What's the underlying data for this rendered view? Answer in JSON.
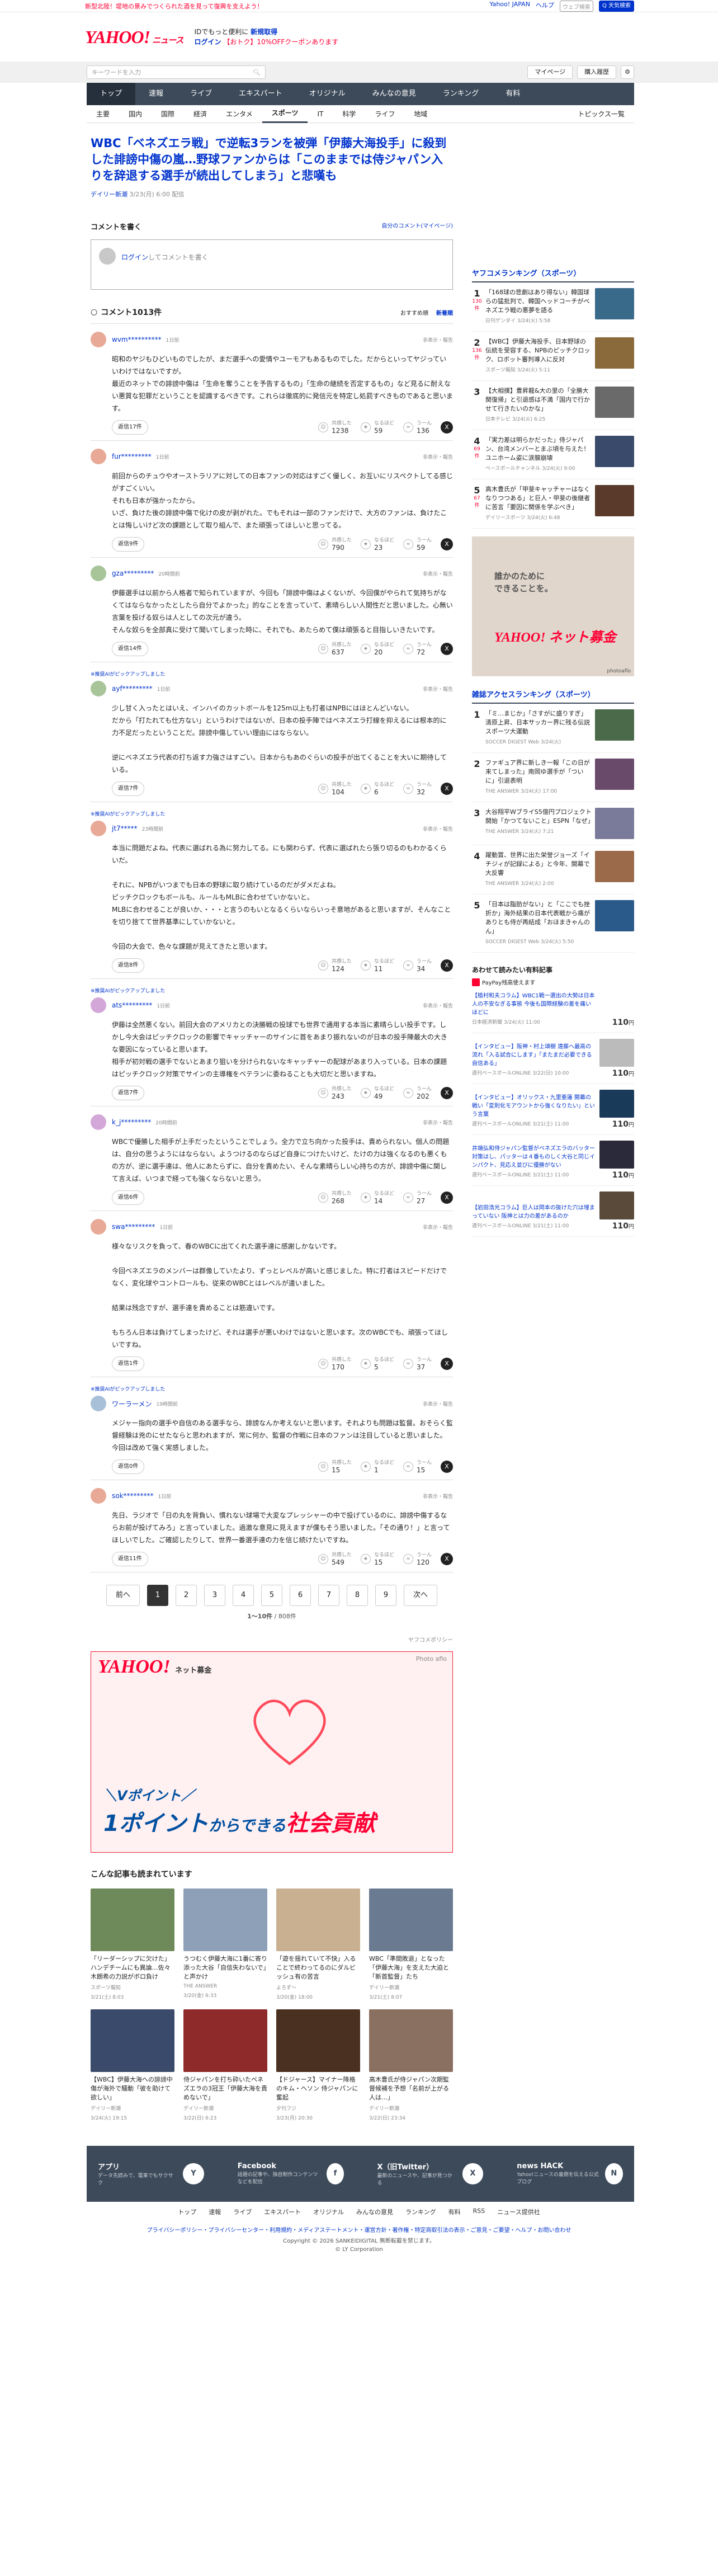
{
  "topstrip": {
    "left": "新型北陸！堤地の景みでつくられた酒を見って復興を支えよう！",
    "links": [
      "Yahoo! JAPAN",
      "ヘルプ"
    ],
    "search_placeholder": "ウェブ検索",
    "search_btn": "Q 天気検索"
  },
  "header": {
    "logo": "YAHOO!",
    "logo_sub": "ニュース",
    "line1": "IDでもっと便利に",
    "line1_link": "新規取得",
    "line2_login": "ログイン",
    "line2_mid": "【おトク】10%OFFクーポンあります",
    "japan": "JAPAN"
  },
  "graybar": {
    "search_placeholder": "キーワードを入力",
    "buttons": [
      "マイページ",
      "購入履歴"
    ]
  },
  "nav1": [
    "トップ",
    "速報",
    "ライブ",
    "エキスパート",
    "オリジナル",
    "みんなの意見",
    "ランキング",
    "有料"
  ],
  "nav2": [
    "主要",
    "国内",
    "国際",
    "経済",
    "エンタメ",
    "スポーツ",
    "IT",
    "科学",
    "ライフ",
    "地域"
  ],
  "nav2_right": "トピックス一覧",
  "article": {
    "title": "WBC「ベネズエラ戦」で逆転3ランを被弾「伊藤大海投手」に殺到した誹謗中傷の嵐…野球ファンからは「このままでは侍ジャパン入りを辞退する選手が続出してしまう」と悲嘆も",
    "source": "デイリー新潮",
    "date": "3/23(月) 6:00",
    "date_suffix": "配信"
  },
  "comment_write": {
    "title": "コメントを書く",
    "link": "自分のコメント(マイページ)",
    "login": "ログイン",
    "placeholder": "してコメントを書く"
  },
  "comments_head": {
    "count": "コメント1013件",
    "sort": [
      "おすすめ順",
      "新着順"
    ]
  },
  "reply_label": "返信",
  "report": "非表示・報告",
  "reactions": [
    "共感した",
    "なるほど",
    "うーん"
  ],
  "comments": [
    {
      "pick": "",
      "name": "wvm**********",
      "time": "1日前",
      "color": "#e8a996",
      "text": "昭和のヤジもひどいものでしたが、まだ選手への愛情やユーモアもあるものでした。だからといってヤジっていいわけではないですが。\n最近のネットでの誹謗中傷は「生命を奪うことを予告するもの」「生命の継続を否定するもの」など見るに耐えない悪質な犯罪だということを認識するべきです。これらは徹底的に発信元を特定し処罰すべきものであると思います。",
      "replies": "返信17件",
      "r": [
        "1238",
        "59",
        "136"
      ]
    },
    {
      "pick": "",
      "name": "fur*********",
      "time": "1日前",
      "color": "#e8a996",
      "text": "前回からのチュウやオーストラリアに対しての日本ファンの対応はすごく優しく、お互いにリスペクトしてる感じがすごくいい。\nそれも日本が強かったから。\nいざ、負けた後の誹謗中傷で化けの皮が剥がれた。でもそれは一部のファンだけで、大方のファンは、負けたことは悔しいけど次の課題として取り組んで、また頑張ってほしいと思ってる。",
      "replies": "返信9件",
      "r": [
        "790",
        "23",
        "59"
      ]
    },
    {
      "pick": "",
      "name": "gza*********",
      "time": "20時間前",
      "color": "#a8c59a",
      "text": "伊藤選手は以前から人格者で知られていますが、今回も「誹謗中傷はよくないが、今回僕がやられて気持ちがなくてはならなかったとしたら自分でよかった」的なことを言っていて、素晴らしい人間性だと思いました。心無い言葉を投げる奴らは人としての次元が違う。\nそんな奴らを全部真に受けて聞いてしまった時に、それでも、あたらめて僕は頑張ると目指しいきたいです。",
      "replies": "返信14件",
      "r": [
        "637",
        "20",
        "72"
      ]
    },
    {
      "pick": "※推奨AIがピックアップしました",
      "name": "ayf*********",
      "time": "1日前",
      "color": "#a8c59a",
      "text": "少し甘く入ったとはいえ、インハイのカットボールを125m以上も打者はNPBにはほとんどいない。\nだから「打たれても仕方ない」というわけではないが、日本の投手陣ではベネズエラ打線を抑えるには根本的に力不足だったということだ。誹謗中傷していい理由にはならない。\n\n逆にベネズエラ代表の打ち返す力強さはすごい。日本からもあのぐらいの投手が出てくることを大いに期待している。",
      "replies": "返信7件",
      "r": [
        "104",
        "6",
        "32"
      ]
    },
    {
      "pick": "※推奨AIがピックアップしました",
      "name": "jt7*****",
      "time": "23時間前",
      "color": "#e8a996",
      "text": "本当に問題だよね。代表に選ばれる為に努力してる。にも関わらず、代表に選ばれたら張り切るのもわかるくらいだ。\n\nそれに、NPBがいつまでも日本の野球に取り続けているのだがダメだよね。\nピッチクロックもボールも、ルールもMLBに合わせていかないと。\nMLBに合わせることが良いか、・・・と言うのもいとなるくらいならいっそ意地があると思いますが、そんなことを切り捨てて世界基準にしていかないと。\n\n今回の大会で、色々な課題が見えてきたと思います。",
      "replies": "返信8件",
      "r": [
        "124",
        "11",
        "34"
      ]
    },
    {
      "pick": "※推奨AIがピックアップしました",
      "name": "ats*********",
      "time": "1日前",
      "color": "#d3a8d8",
      "text": "伊藤は全然悪くない。前回大会のアメリカとの決勝戦の投球でも世界で通用する本当に素晴らしい投手です。しかし今大会はピッチクロックの影響でキャッチャーのサインに首をあまり振れないのが日本の投手陣最大の大きな要因になっていると思います。\n相手が初対戦の選手でないとあまり狙いを分けられないなキャッチャーの配球があまり入っている。日本の課題はピッチクロック対策でサインの主導権をベテランに委ねることも大切だと思いますね。",
      "replies": "返信7件",
      "r": [
        "243",
        "49",
        "202"
      ]
    },
    {
      "pick": "",
      "name": "k_j*********",
      "time": "20時間前",
      "color": "#d3a8d8",
      "text": "WBCで優勝した相手が上手だったということでしょう。全力で立ち向かった投手は、責められない。個人の問題は、自分の思うようにはならない。ようつけるのならばど自身につけたいけど、たけの力は強くなるのも悪くもの方が、逆に選手達は、他人にあたらずに、自分を責めたい、そんな素晴らしい心持ちの方が、誹謗中傷に関して言えば、いつまで経っても強くならないと思う。",
      "replies": "返信6件",
      "r": [
        "268",
        "14",
        "27"
      ]
    },
    {
      "pick": "",
      "name": "swa*********",
      "time": "1日前",
      "color": "#e8a996",
      "text": "様々なリスクを負って、春のWBCに出てくれた選手達に感謝しかないです。\n\n今回ベネズエラのメンバーは群像していたより、ずっとレベルが高いと感じました。特に打者はスピードだけでなく、変化球やコントロールも、従来のWBCとはレベルが違いました。\n\n結果は残念ですが、選手達を責めることは筋違いです。\n\nもちろん日本は負けてしまったけど、それは選手が悪いわけではないと思います。次のWBCでも、頑張ってほしいですね。",
      "replies": "返信1件",
      "r": [
        "170",
        "5",
        "37"
      ]
    },
    {
      "pick": "※推奨AIがピックアップしました",
      "name": "ワーラーメン",
      "time": "19時間前",
      "color": "#a8c0d8",
      "text": "メジャー指向の選手や自信のある選手なら、誹謗なんか考えないと思います。それよりも問題は監督。おそらく監督経験は兇のにせたならと思われますが、常に何か、監督の作戦に日本のファンは注目していると思いました。今回は改めて強く実感しました。",
      "replies": "返信0件",
      "r": [
        "15",
        "1",
        "15"
      ]
    },
    {
      "pick": "",
      "name": "sok*********",
      "time": "1日前",
      "color": "#e8a996",
      "text": "先日、ラジオで「日の丸を背負い、慣れない球場で大変なプレッシャーの中で投げているのに、誹謗中傷するならお前が投げてみろ」と言っていました。過激な意見に見えますが僕もそう思いました。「その通り！」と言ってほしいでした。ご確認したりして、世界一番選手達の力を信じ続けたいですね。",
      "replies": "返信11件",
      "r": [
        "549",
        "15",
        "120"
      ]
    }
  ],
  "pagination": {
    "prev": "前へ",
    "pages": [
      "1",
      "2",
      "3",
      "4",
      "5",
      "6",
      "7",
      "8",
      "9"
    ],
    "next": "次へ",
    "info": "1〜10件",
    "total": "/ 808件"
  },
  "yahoo_policy": "ヤフコメポリシー",
  "ad": {
    "logo": "YAHOO!",
    "logo_sub": "ネット募金",
    "photo": "Photo aflo",
    "line1": "＼Vポイント／",
    "line2a": "1ポイント",
    "line2b": "からできる",
    "line2c": "社会貢献"
  },
  "recommend": {
    "title": "こんな記事も読まれています",
    "items": [
      {
        "t": "「リーダーシップに欠けた」ハンデチームにも異論…佐々木朗希の力説がボロ負け",
        "s": "スポーツ報知",
        "d": "3/21(土) 8:03",
        "c": "#6f8a5a"
      },
      {
        "t": "うつむく伊藤大海に1番に寄り添った大谷「自信失わないで」と声かけ",
        "s": "THE ANSWER",
        "d": "3/20(金) 6:33",
        "c": "#8ea0b8"
      },
      {
        "t": "「遊を揺れていて不快」入ることで終わってるのにダルビッシュ有の苦言",
        "s": "よろず〜",
        "d": "3/20(金) 18:00",
        "c": "#c8b090"
      },
      {
        "t": "WBC「準間敗退」となった「伊藤大海」を支えた大迫と「新首監督」たち",
        "s": "デイリー新潮",
        "d": "3/21(土) 8:07",
        "c": "#6a7a90"
      },
      {
        "t": "【WBC】伊藤大海への誹謗中傷が海外で騒動「彼を助けて欲しい」",
        "s": "デイリー新潮",
        "d": "3/24(火) 19:15",
        "c": "#3a4a6a"
      },
      {
        "t": "侍ジャパンを打ち砕いたベネズエラの3冠王「伊藤大海を責めないで」",
        "s": "デイリー新潮",
        "d": "3/22(日) 6:23",
        "c": "#8e2a2a"
      },
      {
        "t": "【ドジャース】マイナー降格のキム・ヘソン 侍ジャパンに奮起",
        "s": "夕刊フジ",
        "d": "3/23(月) 20:30",
        "c": "#4a3020"
      },
      {
        "t": "高木豊氏が侍ジャパン次期監督候補を予想「名前が上がる人は…」",
        "s": "デイリー新潮",
        "d": "3/22(日) 23:34",
        "c": "#8a7060"
      }
    ]
  },
  "footer": {
    "items": [
      {
        "t": "アプリ",
        "d": "データ先読みで、電車でもサクサク",
        "ic": "Y"
      },
      {
        "t": "Facebook",
        "d": "話題の記事や、独自制作コンテンツなどを配信",
        "ic": "f"
      },
      {
        "t": "X（旧Twitter）",
        "d": "最新のニュースや、記事が見つかる",
        "ic": "X"
      },
      {
        "t": "news HACK",
        "d": "Yahoo!ニュースの裏側を伝える公式ブログ",
        "ic": "N"
      }
    ],
    "nav": [
      "トップ",
      "速報",
      "ライブ",
      "エキスパート",
      "オリジナル",
      "みんなの意見",
      "ランキング",
      "有料",
      "RSS",
      "ニュース提供社"
    ],
    "links": "プライバシーポリシー・プライバシーセンター・利用規約・メディアステートメント・運営方針・著作権・特定商取引法の表示・ご意見・ご要望・ヘルプ・お問い合わせ",
    "copy1": "Copyright © 2026 SANKEIDIGITAL 無断転載を禁じます。",
    "copy2": "© LY Corporation"
  },
  "side": {
    "rank_title": "ヤフコメランキング（スポーツ）",
    "rank": [
      {
        "n": "1",
        "c": "130件",
        "t": "「168球の悲劇はあり得ない」韓国球らの猛批判で、韓国ヘッドコーチがベネズエラ戦の悪夢を語る",
        "s": "日刊ゲンダイ 3/24(火) 5:58",
        "col": "#3a6a8a"
      },
      {
        "n": "2",
        "c": "136件",
        "t": "【WBC】伊藤大海投手、日本野球の伝統を受容する、NPBのピッチクロック、ロボット審判導入に反対",
        "s": "スポーツ報知 3/24(火) 5:11",
        "col": "#8a6a3a"
      },
      {
        "n": "3",
        "c": "",
        "t": "【大相撲】豊昇龍&大の里の「全勝大関復帰」と引退感は不満「国内で行かせて行きたいのかな」",
        "s": "日本テレビ 3/24(火) 6:25",
        "col": "#6a6a6a"
      },
      {
        "n": "4",
        "c": "69件",
        "t": "「実力差は明らかだった」侍ジャパン、台湾メンバーとまぶ頃を与えた！ユニホーム姿に涙腺崩壊",
        "s": "ベースボールチャンネル 3/24(火) 9:00",
        "col": "#3a4a6a"
      },
      {
        "n": "5",
        "c": "67件",
        "t": "高木豊氏が「甲斐キャッチャーはなくなりつつある」と巨人・甲斐の後継者に苦言「要因に関係を学ぶべき」",
        "s": "デイリースポーツ 3/24(火) 6:48",
        "col": "#5a3a2a"
      }
    ],
    "banner_t": "誰かのために\nできることを。",
    "banner_y": "YAHOO! ネット募金",
    "banner_p": "photoaflo",
    "access_title": "雑誌アクセスランキング（スポーツ）",
    "access": [
      {
        "n": "1",
        "t": "「ミ…まじか」「さすがに盛りすぎ」清原上昇、日本サッカー界に残る伝説スポーツ大運動",
        "s": "SOCCER DIGEST Web 3/24(火)",
        "col": "#4a6a4a"
      },
      {
        "n": "2",
        "t": "ファギュア界に新しき一報「この日が来てしまった」南岡ゆ選手が「ついに」引退表明",
        "s": "THE ANSWER 3/24(火) 17:00",
        "col": "#6a4a6a"
      },
      {
        "n": "3",
        "t": "大谷翔平WブライS5億円プロジェクト開始「かつてないこと」ESPN「なぜ」",
        "s": "THE ANSWER 3/24(火) 7:21",
        "col": "#7a7a9a"
      },
      {
        "n": "4",
        "t": "躍動賞、世界に出た栄誉ジョーズ「イチジィが記録による」と今年、開幕で大反響",
        "s": "THE ANSWER 3/24(火) 2:00",
        "col": "#9a6a4a"
      },
      {
        "n": "5",
        "t": "「日本は脂肪がない」と「ここでも挫折か」海外結果の日本代表戦から痛がありとも侍が再結成「おほまきゃんのん」",
        "s": "SOCCER DIGEST Web 3/24(火) 5:50",
        "col": "#2a5a8a"
      }
    ],
    "pay_title": "あわせて読みたい有料記事",
    "pay_badge": "PayPay残高使えます",
    "pay": [
      {
        "t": "【植村和夫コラム】WBC1戦一選出の大勢は日本人の不安なぎる事態 今後も国際経験の差を痛いほどに",
        "s": "日本経済新聞 3/24(火) 11:00",
        "v": "110",
        "col": ""
      },
      {
        "t": "【インタビュー】阪神・村上頌樹 遠藤へ最高の流れ「入る試合にします」「またまだ必要できる自信ある」",
        "s": "週刊ベースボールONLINE 3/22(日) 10:00",
        "v": "110",
        "col": "#bbb"
      },
      {
        "t": "【インタビュー】オリックス・九里亜蓮 開幕の戦い「変則化モアウントから強くなりたい」という言葉",
        "s": "週刊ベースボールONLINE 3/21(土) 11:00",
        "v": "110",
        "col": "#1a3a5a"
      },
      {
        "t": "井端弘和侍ジャパン監督がベネズエラのバッター対策はし、パッターは４番ものしく大谷と同じインパクト、見応え並びに優勝がない",
        "s": "週刊ベースボールONLINE 3/21(土) 11:00",
        "v": "110",
        "col": "#2a2a3a"
      },
      {
        "t": "【岩田浩光コラム】巨人は岡本の抜けた穴は埋まっていない 阪神とは力の差があるのか",
        "s": "週刊ベースボールONLINE 3/21(土) 11:00",
        "v": "110",
        "col": "#5a4a3a"
      }
    ],
    "yen": "円"
  }
}
